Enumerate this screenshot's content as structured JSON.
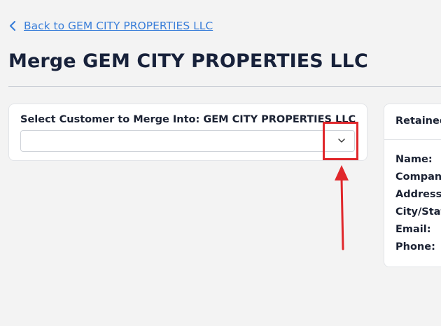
{
  "nav": {
    "back_label": "Back to GEM CITY PROPERTIES LLC"
  },
  "page": {
    "title": "Merge GEM CITY PROPERTIES LLC"
  },
  "merge_panel": {
    "select_label": "Select Customer to Merge Into: GEM CITY PROPERTIES LLC",
    "select_value": ""
  },
  "retained_panel": {
    "header": "Retained",
    "fields": [
      "Name:",
      "Company:",
      "Address:",
      "City/State:",
      "Email:",
      "Phone:"
    ]
  },
  "annotation": {
    "color": "#e0272b"
  },
  "colors": {
    "link": "#3b7fd9",
    "title": "#17213a",
    "background": "#f3f3f3"
  }
}
